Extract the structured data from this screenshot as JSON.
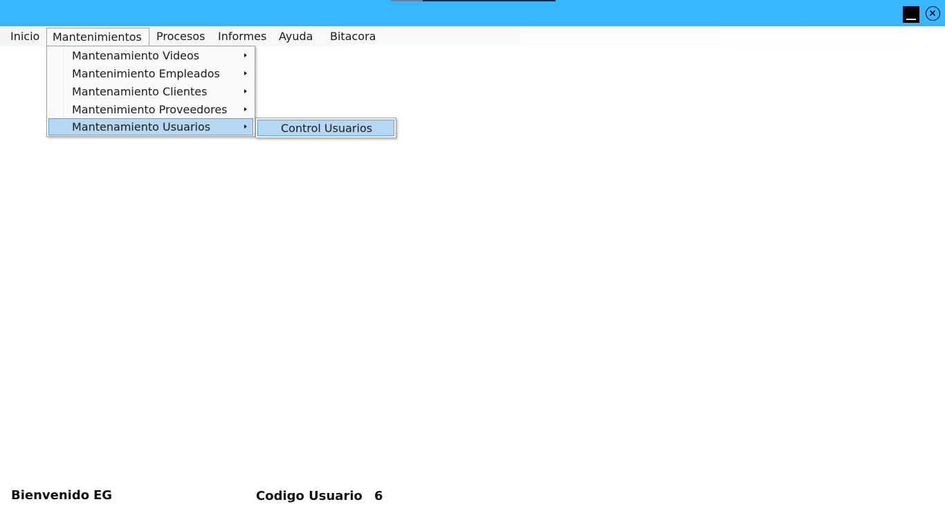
{
  "colors": {
    "titlebar": "#38b6ff",
    "menu_highlight": "#b5d7f3",
    "menu_highlight_border": "#5f9ed6"
  },
  "window_controls": {
    "minimize_icon": "minimize-icon",
    "close_icon": "close-icon"
  },
  "menubar": {
    "items": [
      {
        "label": "Inicio"
      },
      {
        "label": "Mantenimientos"
      },
      {
        "label": "Procesos"
      },
      {
        "label": "Informes"
      },
      {
        "label": "Ayuda"
      },
      {
        "label": "Bitacora"
      }
    ]
  },
  "dropdown": {
    "items": [
      {
        "label": "Mantenamiento Videos"
      },
      {
        "label": "Mantenimiento Empleados"
      },
      {
        "label": "Mantenamiento Clientes"
      },
      {
        "label": "Mantenimiento Proveedores"
      },
      {
        "label": "Mantenamiento Usuarios"
      }
    ]
  },
  "submenu": {
    "items": [
      {
        "label": "Control Usuarios"
      }
    ]
  },
  "status": {
    "welcome_label": "Bienvenido",
    "user_name": "EG",
    "user_code_label": "Codigo Usuario",
    "user_code": "6"
  }
}
